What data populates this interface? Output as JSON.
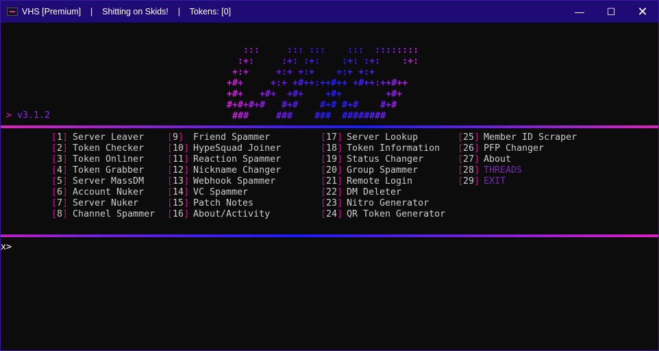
{
  "window": {
    "title_parts": [
      "VHS [Premium]",
      "Shitting on Skids!",
      "Tokens: [0]"
    ],
    "separator": "|"
  },
  "banner": {
    "art": [
      "   :::     ::: :::    :::  ::::::::",
      "  :+:     :+: :+:    :+: :+:    :+:",
      " +:+     +:+ +:+    +:+ +:+",
      "+#+     +:+ +#++:++#++ +#++:++#++",
      "+#+   +#+  +#+    +#+        +#+",
      "#+#+#+#   #+#    #+# #+#    #+#",
      " ###     ###    ###  ########"
    ],
    "version_prefix": ">",
    "version": "v3.1.2"
  },
  "menu": {
    "columns": [
      [
        {
          "n": "1",
          "label": "Server Leaver"
        },
        {
          "n": "2",
          "label": "Token Checker"
        },
        {
          "n": "3",
          "label": "Token Onliner"
        },
        {
          "n": "4",
          "label": "Token Grabber"
        },
        {
          "n": "5",
          "label": "Server MassDM"
        },
        {
          "n": "6",
          "label": "Account Nuker"
        },
        {
          "n": "7",
          "label": "Server Nuker"
        },
        {
          "n": "8",
          "label": "Channel Spammer"
        }
      ],
      [
        {
          "n": "9",
          "label": "Friend Spammer"
        },
        {
          "n": "10",
          "label": "HypeSquad Joiner"
        },
        {
          "n": "11",
          "label": "Reaction Spammer"
        },
        {
          "n": "12",
          "label": "Nickname Changer"
        },
        {
          "n": "13",
          "label": "Webhook Spammer"
        },
        {
          "n": "14",
          "label": "VC Spammer"
        },
        {
          "n": "15",
          "label": "Patch Notes"
        },
        {
          "n": "16",
          "label": "About/Activity"
        }
      ],
      [
        {
          "n": "17",
          "label": "Server Lookup"
        },
        {
          "n": "18",
          "label": "Token Information"
        },
        {
          "n": "19",
          "label": "Status Changer"
        },
        {
          "n": "20",
          "label": "Group Spammer"
        },
        {
          "n": "21",
          "label": "Remote Login"
        },
        {
          "n": "22",
          "label": "DM Deleter"
        },
        {
          "n": "23",
          "label": "Nitro Generator"
        },
        {
          "n": "24",
          "label": "QR Token Generator"
        }
      ],
      [
        {
          "n": "25",
          "label": "Member ID Scraper"
        },
        {
          "n": "26",
          "label": "PFP Changer"
        },
        {
          "n": "27",
          "label": "About"
        },
        {
          "n": "28",
          "label": "THREADS",
          "highlight": true
        },
        {
          "n": "29",
          "label": "EXIT",
          "highlight": true
        }
      ]
    ]
  },
  "prompt": "x>",
  "colors": {
    "titlebar": "#1e0c74",
    "bracket": "#c0108a",
    "highlight": "#7a2ab0",
    "version": "#8a2be2"
  }
}
